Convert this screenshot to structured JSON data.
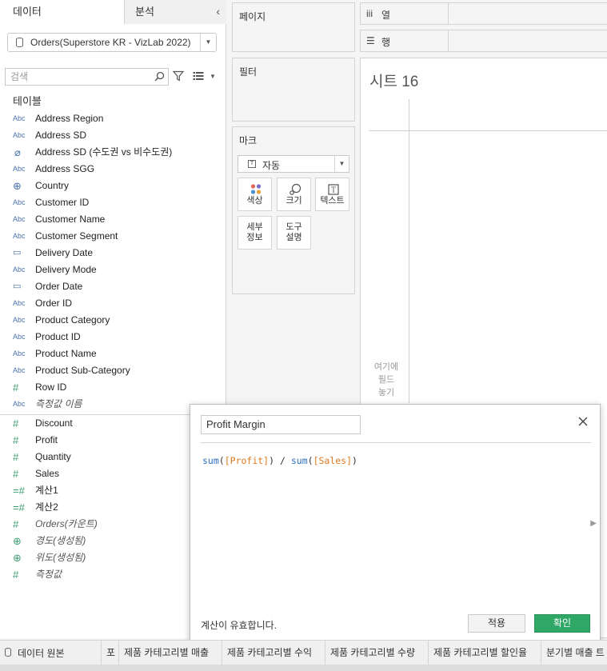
{
  "left_pane": {
    "tab_data": "데이터",
    "tab_analysis": "분석",
    "datasource": "Orders(Superstore KR - VizLab 2022)",
    "search_placeholder": "검색",
    "tables_heading": "테이블",
    "dimensions": [
      {
        "icon": "Abc",
        "name": "Address Region"
      },
      {
        "icon": "Abc",
        "name": "Address SD"
      },
      {
        "icon": "clip",
        "name": "Address SD (수도권 vs 비수도권)"
      },
      {
        "icon": "Abc",
        "name": "Address SGG"
      },
      {
        "icon": "globe",
        "name": "Country"
      },
      {
        "icon": "Abc",
        "name": "Customer ID"
      },
      {
        "icon": "Abc",
        "name": "Customer Name"
      },
      {
        "icon": "Abc",
        "name": "Customer Segment"
      },
      {
        "icon": "calendar",
        "name": "Delivery Date"
      },
      {
        "icon": "Abc",
        "name": "Delivery Mode"
      },
      {
        "icon": "calendar",
        "name": "Order Date"
      },
      {
        "icon": "Abc",
        "name": "Order ID"
      },
      {
        "icon": "Abc",
        "name": "Product Category"
      },
      {
        "icon": "Abc",
        "name": "Product ID"
      },
      {
        "icon": "Abc",
        "name": "Product Name"
      },
      {
        "icon": "Abc",
        "name": "Product Sub-Category"
      },
      {
        "icon": "#",
        "name": "Row ID"
      },
      {
        "icon": "Abc",
        "name": "측정값 이름",
        "italic": true
      }
    ],
    "measures": [
      {
        "icon": "#",
        "name": "Discount"
      },
      {
        "icon": "#",
        "name": "Profit"
      },
      {
        "icon": "#",
        "name": "Quantity"
      },
      {
        "icon": "#",
        "name": "Sales"
      },
      {
        "icon": "=#",
        "name": "계산1"
      },
      {
        "icon": "=#",
        "name": "계산2"
      },
      {
        "icon": "#",
        "name": "Orders(카운트)",
        "italic": true
      },
      {
        "icon": "globe",
        "name": "경도(생성됨)",
        "italic": true
      },
      {
        "icon": "globe",
        "name": "위도(생성됨)",
        "italic": true
      },
      {
        "icon": "#",
        "name": "측정값",
        "italic": true
      }
    ]
  },
  "cards": {
    "pages": "페이지",
    "filters": "필터",
    "marks": "마크",
    "mark_type": "자동",
    "mark_buttons": {
      "color": "색상",
      "size": "크기",
      "label": "텍스트",
      "detail": "세부\n정보",
      "tooltip": "도구\n설명"
    }
  },
  "shelves": {
    "columns_icon": "iii",
    "columns": "열",
    "rows_icon": "☰",
    "rows": "행"
  },
  "sheet": {
    "title": "시트 16",
    "drop_hint": "여기에\n필드\n놓기"
  },
  "calc_dialog": {
    "name": "Profit Margin",
    "formula": {
      "f1": "sum",
      "a1": "[Profit]",
      "op": "/",
      "f2": "sum",
      "a2": "[Sales]"
    },
    "status": "계산이 유효합니다.",
    "apply": "적용",
    "ok": "확인"
  },
  "tabbar": {
    "datasource_tab": "데이터 원본",
    "sheets": [
      "포",
      "제품 카테고리별 매출",
      "제품 카테고리별 수익",
      "제품 카테고리별 수량",
      "제품 카테고리별 할인율",
      "분기별 매출 트"
    ]
  },
  "colors": {
    "accent_green": "#2fa866",
    "dimension_blue": "#4a72a8",
    "measure_green": "#3f9e72",
    "formula_function": "#2f6fbf",
    "formula_field": "#e07a20"
  }
}
